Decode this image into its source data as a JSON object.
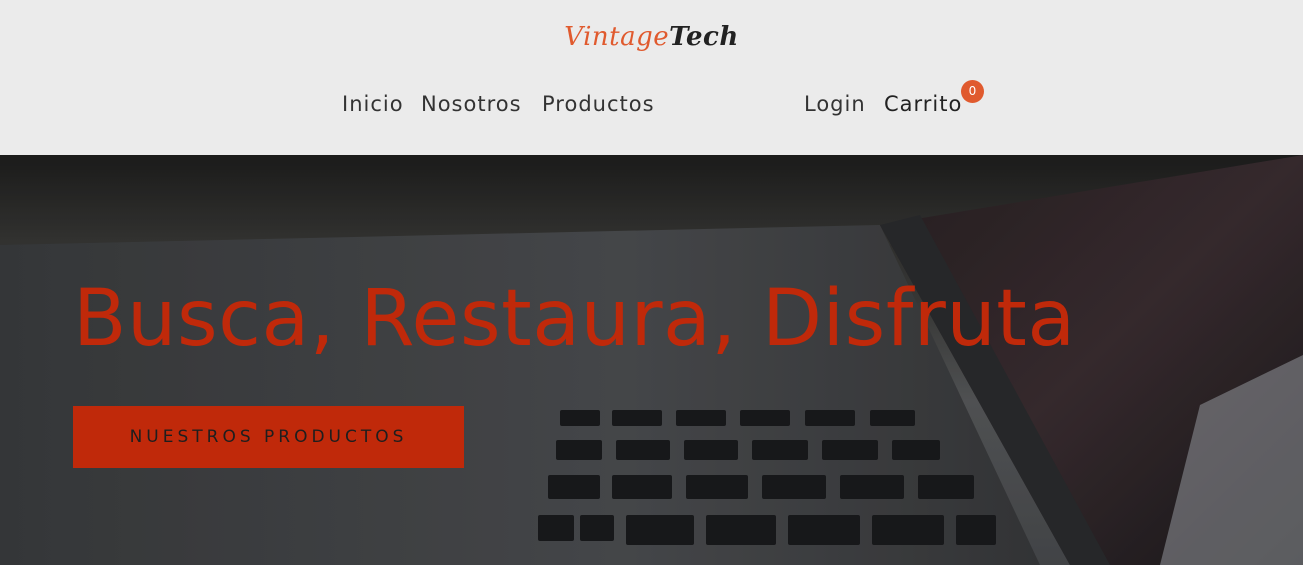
{
  "header": {
    "logo": {
      "part1": "Vintage",
      "part2": "Tech"
    },
    "nav": {
      "inicio": "Inicio",
      "nosotros": "Nosotros",
      "productos": "Productos",
      "login": "Login",
      "carrito": "Carrito",
      "cart_count": "0"
    }
  },
  "hero": {
    "title": "Busca, Restaura, Disfruta",
    "button_label": "NUESTROS PRODUCTOS"
  },
  "colors": {
    "accent": "#c0290a",
    "logo_accent": "#e05a2e",
    "header_bg": "#ebebeb"
  }
}
